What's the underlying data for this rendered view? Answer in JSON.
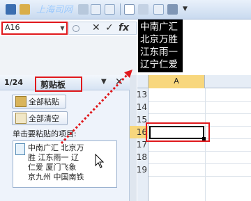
{
  "name_box": {
    "value": "A16"
  },
  "formula_bar": {
    "cancel": "✕",
    "enter": "✓",
    "fx": "fx"
  },
  "preview": {
    "lines": [
      "中南广汇",
      "北京万胜",
      "江东雨一",
      "辽宁仁爱"
    ]
  },
  "watermark": "上海司网",
  "clipboard_pane": {
    "count": "1/24",
    "title": "剪贴板",
    "options_glyph": "▼",
    "close_glyph": "✕",
    "paste_all": "全部粘贴",
    "clear_all": "全部清空",
    "label": "单击要粘贴的项目:",
    "item_lines": [
      "中南广汇 北京万",
      "胜 江东雨一 辽",
      "仁爱 厦门飞象",
      "京九州 中国南铁"
    ]
  },
  "sheet": {
    "column": "A",
    "rows": [
      "13",
      "14",
      "15",
      "16",
      "17",
      "18",
      "19"
    ],
    "selected_row": "16"
  },
  "colors": {
    "highlight_red": "#e0181c",
    "selection": "#f8d77d"
  }
}
